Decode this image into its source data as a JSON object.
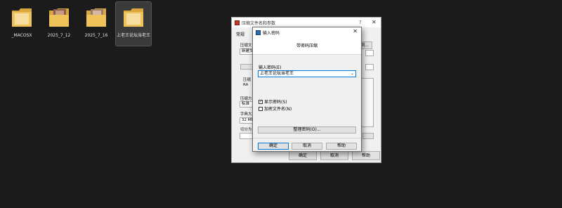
{
  "desktop": {
    "folders": [
      {
        "label": "_MACOSX"
      },
      {
        "label": "2025_7_12"
      },
      {
        "label": "2025_7_16"
      },
      {
        "label": "上老王论坛当老王"
      }
    ]
  },
  "background_dialog": {
    "title": "压缩文件名和参数",
    "help_glyph": "?",
    "close_glyph": "✕",
    "tab_general": "常规",
    "label_archive": "压缩文",
    "archive_value": "新建文",
    "label_format": "压缩",
    "radio_value": "RA",
    "label_method": "压缩方",
    "method_value": "标准",
    "label_dict": "字典大",
    "dict_value": "32 MB",
    "label_split": "切分为",
    "browse_btn": "浏...",
    "ok": "确定",
    "cancel": "取消",
    "help": "帮助"
  },
  "password_dialog": {
    "title": "输入密码",
    "close_glyph": "✕",
    "header": "带密码压缩",
    "password_label": "输入密码(E)",
    "password_value": "上老王论坛当老王",
    "show_password_label": "显示密码(S)",
    "show_password_checked": true,
    "encrypt_names_label": "加密文件名(N)",
    "encrypt_names_checked": false,
    "organize_button": "整理密码(O)...",
    "ok": "确定",
    "cancel": "取消",
    "help": "帮助"
  },
  "colors": {
    "accent": "#0078d7",
    "desktop_bg": "#1b1b1b",
    "folder": "#e8b84a"
  }
}
